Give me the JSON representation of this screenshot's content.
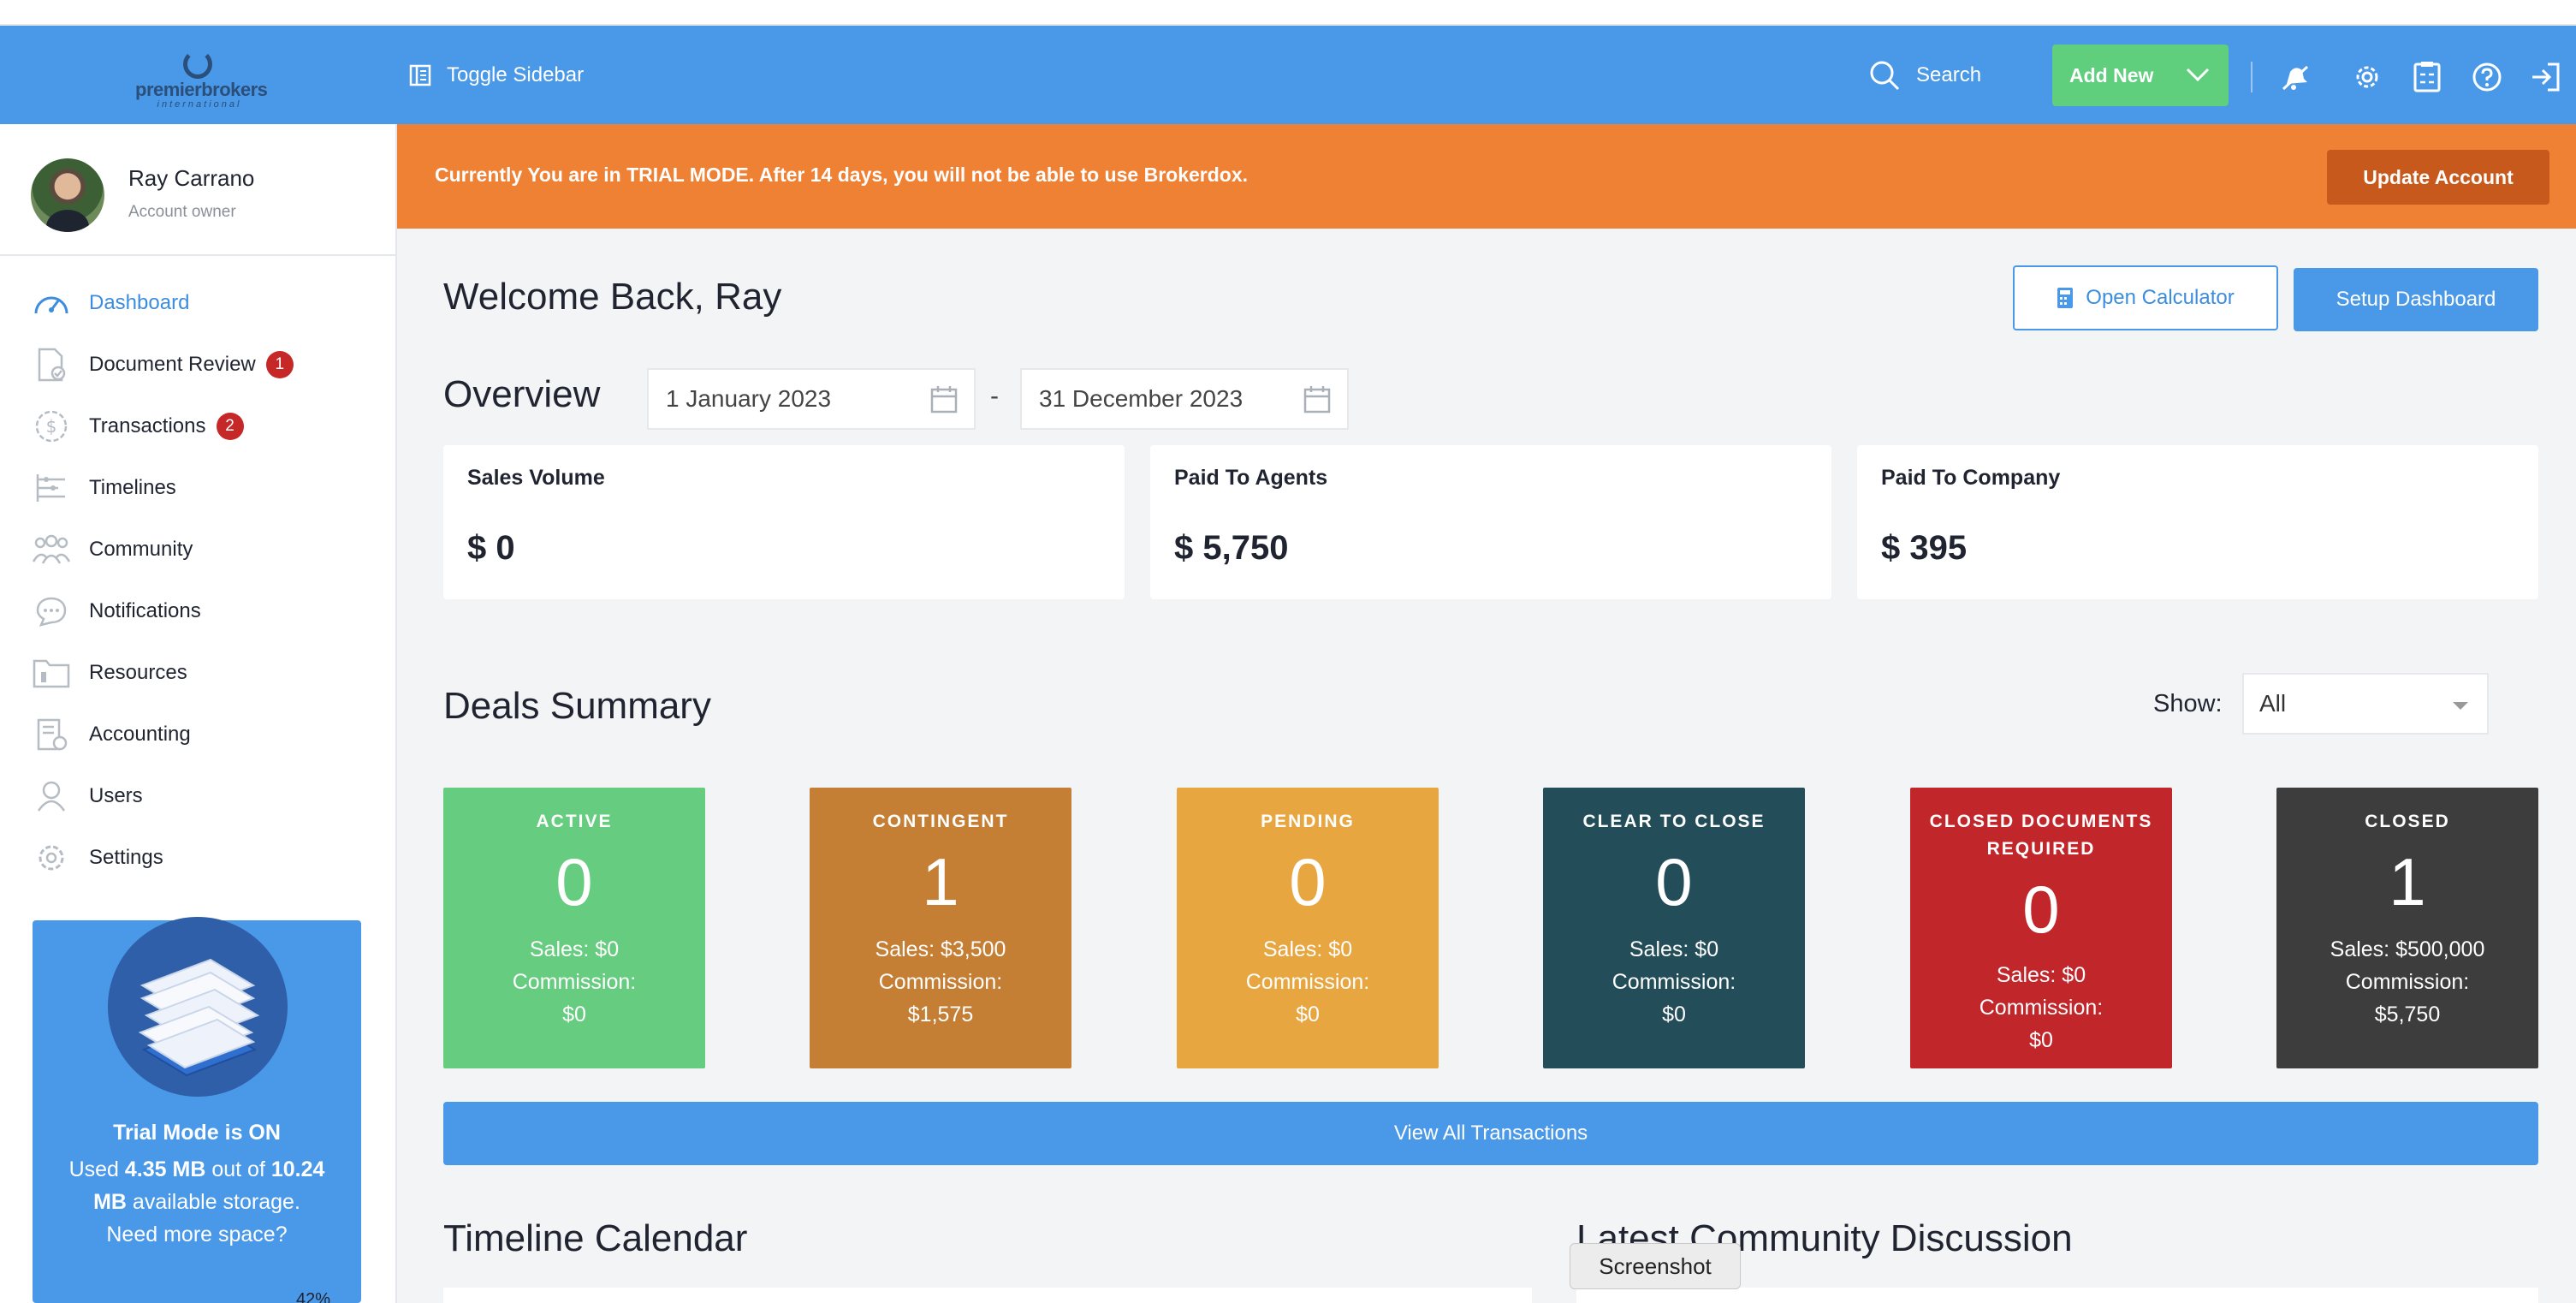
{
  "header": {
    "logo_text": "premierbrokers",
    "logo_sub": "international",
    "toggle_label": "Toggle Sidebar",
    "search_label": "Search",
    "add_new_label": "Add New",
    "icons": [
      "bell-off-icon",
      "gear-icon",
      "calculator-icon",
      "help-icon",
      "logout-icon"
    ]
  },
  "user": {
    "name": "Ray Carrano",
    "role": "Account owner"
  },
  "sidebar": {
    "items": [
      {
        "label": "Dashboard",
        "icon": "dashboard-gauge-icon",
        "active": true
      },
      {
        "label": "Document Review",
        "icon": "document-check-icon",
        "badge": "1"
      },
      {
        "label": "Transactions",
        "icon": "dollar-circle-icon",
        "badge": "2"
      },
      {
        "label": "Timelines",
        "icon": "timeline-icon"
      },
      {
        "label": "Community",
        "icon": "people-icon"
      },
      {
        "label": "Notifications",
        "icon": "chat-bubble-icon"
      },
      {
        "label": "Resources",
        "icon": "folder-icon"
      },
      {
        "label": "Accounting",
        "icon": "ledger-icon"
      },
      {
        "label": "Users",
        "icon": "user-icon"
      },
      {
        "label": "Settings",
        "icon": "gear-icon"
      }
    ]
  },
  "trial": {
    "title": "Trial Mode is ON",
    "used_prefix": "Used ",
    "used_value": "4.35 MB",
    "used_middle": " out of ",
    "total_value": "10.24 MB",
    "used_suffix": " available storage.",
    "need_more": "Need more space?",
    "percent_label": "42%",
    "percent": 42
  },
  "banner": {
    "text": "Currently You are in TRIAL MODE. After 14 days, you will not be able to use Brokerdox.",
    "button": "Update Account"
  },
  "main": {
    "welcome": "Welcome Back, Ray",
    "open_calculator": "Open Calculator",
    "setup_dashboard": "Setup Dashboard",
    "overview_title": "Overview",
    "date_from": "1 January 2023",
    "date_sep": "-",
    "date_to": "31 December 2023",
    "stats": [
      {
        "label": "Sales Volume",
        "value": "$ 0"
      },
      {
        "label": "Paid To Agents",
        "value": "$ 5,750"
      },
      {
        "label": "Paid To Company",
        "value": "$ 395"
      }
    ],
    "deals_title": "Deals Summary",
    "show_label": "Show:",
    "show_value": "All",
    "deals": [
      {
        "name": "ACTIVE",
        "count": "0",
        "sales": "Sales: $0",
        "commission_label": "Commission:",
        "commission": "$0",
        "color": "#66cc7f"
      },
      {
        "name": "CONTINGENT",
        "count": "1",
        "sales": "Sales: $3,500",
        "commission_label": "Commission:",
        "commission": "$1,575",
        "color": "#c47f35"
      },
      {
        "name": "PENDING",
        "count": "0",
        "sales": "Sales: $0",
        "commission_label": "Commission:",
        "commission": "$0",
        "color": "#e8a641"
      },
      {
        "name": "CLEAR TO CLOSE",
        "count": "0",
        "sales": "Sales: $0",
        "commission_label": "Commission:",
        "commission": "$0",
        "color": "#234d58"
      },
      {
        "name": "CLOSED DOCUMENTS REQUIRED",
        "count": "0",
        "sales": "Sales: $0",
        "commission_label": "Commission:",
        "commission": "$0",
        "color": "#c1262a"
      },
      {
        "name": "CLOSED",
        "count": "1",
        "sales": "Sales: $500,000",
        "commission_label": "Commission:",
        "commission": "$5,750",
        "color": "#3d3d3d"
      }
    ],
    "view_all": "View All Transactions",
    "timeline_title": "Timeline Calendar",
    "community_title": "Latest Community Discussion"
  },
  "tooltip": "Screenshot"
}
